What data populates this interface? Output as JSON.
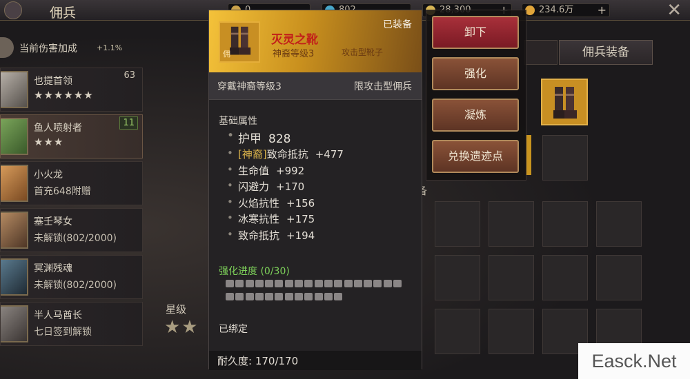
{
  "header": {
    "title": "佣兵",
    "resources": [
      {
        "value": "0",
        "color": "#caa24a"
      },
      {
        "value": "802",
        "color": "#47a6c9"
      },
      {
        "value": "28,300",
        "color": "#d6b454"
      },
      {
        "value": "234.6万",
        "color": "#e0a53a"
      }
    ]
  },
  "bonus": {
    "label": "当前伤害加成",
    "value": "+1.1%"
  },
  "mercenaries": [
    {
      "name": "也提首领",
      "stars": "★★★★★★",
      "level": "63",
      "sub": ""
    },
    {
      "name": "鱼人喷射者",
      "stars": "★★★",
      "level": "11",
      "sub": ""
    },
    {
      "name": "小火龙",
      "stars": "",
      "level": "",
      "sub": "首充648附赠"
    },
    {
      "name": "塞壬琴女",
      "stars": "",
      "level": "",
      "sub": "未解锁(802/2000)"
    },
    {
      "name": "冥渊残魂",
      "stars": "",
      "level": "",
      "sub": "未解锁(802/2000)"
    },
    {
      "name": "半人马酋长",
      "stars": "",
      "level": "",
      "sub": "七日签到解锁"
    }
  ],
  "star_section": {
    "label": "星级",
    "stars": "★★"
  },
  "right_panel": {
    "tab": "佣兵装备",
    "grid_label": "备"
  },
  "actions": {
    "unequip": "卸下",
    "enhance": "强化",
    "refine": "凝炼",
    "exchange": "兑换遗迹点"
  },
  "tooltip": {
    "icon_tag": "佣",
    "name": "灭灵之靴",
    "tier": "神裔等级3",
    "type": "攻击型靴子",
    "state": "已装备",
    "wear_req": "穿戴神裔等级3",
    "merc_req": "限攻击型佣兵",
    "base_title": "基础属性",
    "attrs": [
      {
        "tag": "",
        "name": "护甲",
        "value": "828"
      },
      {
        "tag": "[神裔]",
        "name": "致命抵抗",
        "value": "+477"
      },
      {
        "tag": "",
        "name": "生命值",
        "value": "+992"
      },
      {
        "tag": "",
        "name": "闪避力",
        "value": "+170"
      },
      {
        "tag": "",
        "name": "火焰抗性",
        "value": "+156"
      },
      {
        "tag": "",
        "name": "冰寒抗性",
        "value": "+175"
      },
      {
        "tag": "",
        "name": "致命抵抗",
        "value": "+194"
      }
    ],
    "enhance_label": "强化进度 (0/30)",
    "enhance_progress": 0,
    "enhance_max": 30,
    "bound": "已绑定",
    "durability": "耐久度: 170/170"
  },
  "watermark": "Easck.Net"
}
